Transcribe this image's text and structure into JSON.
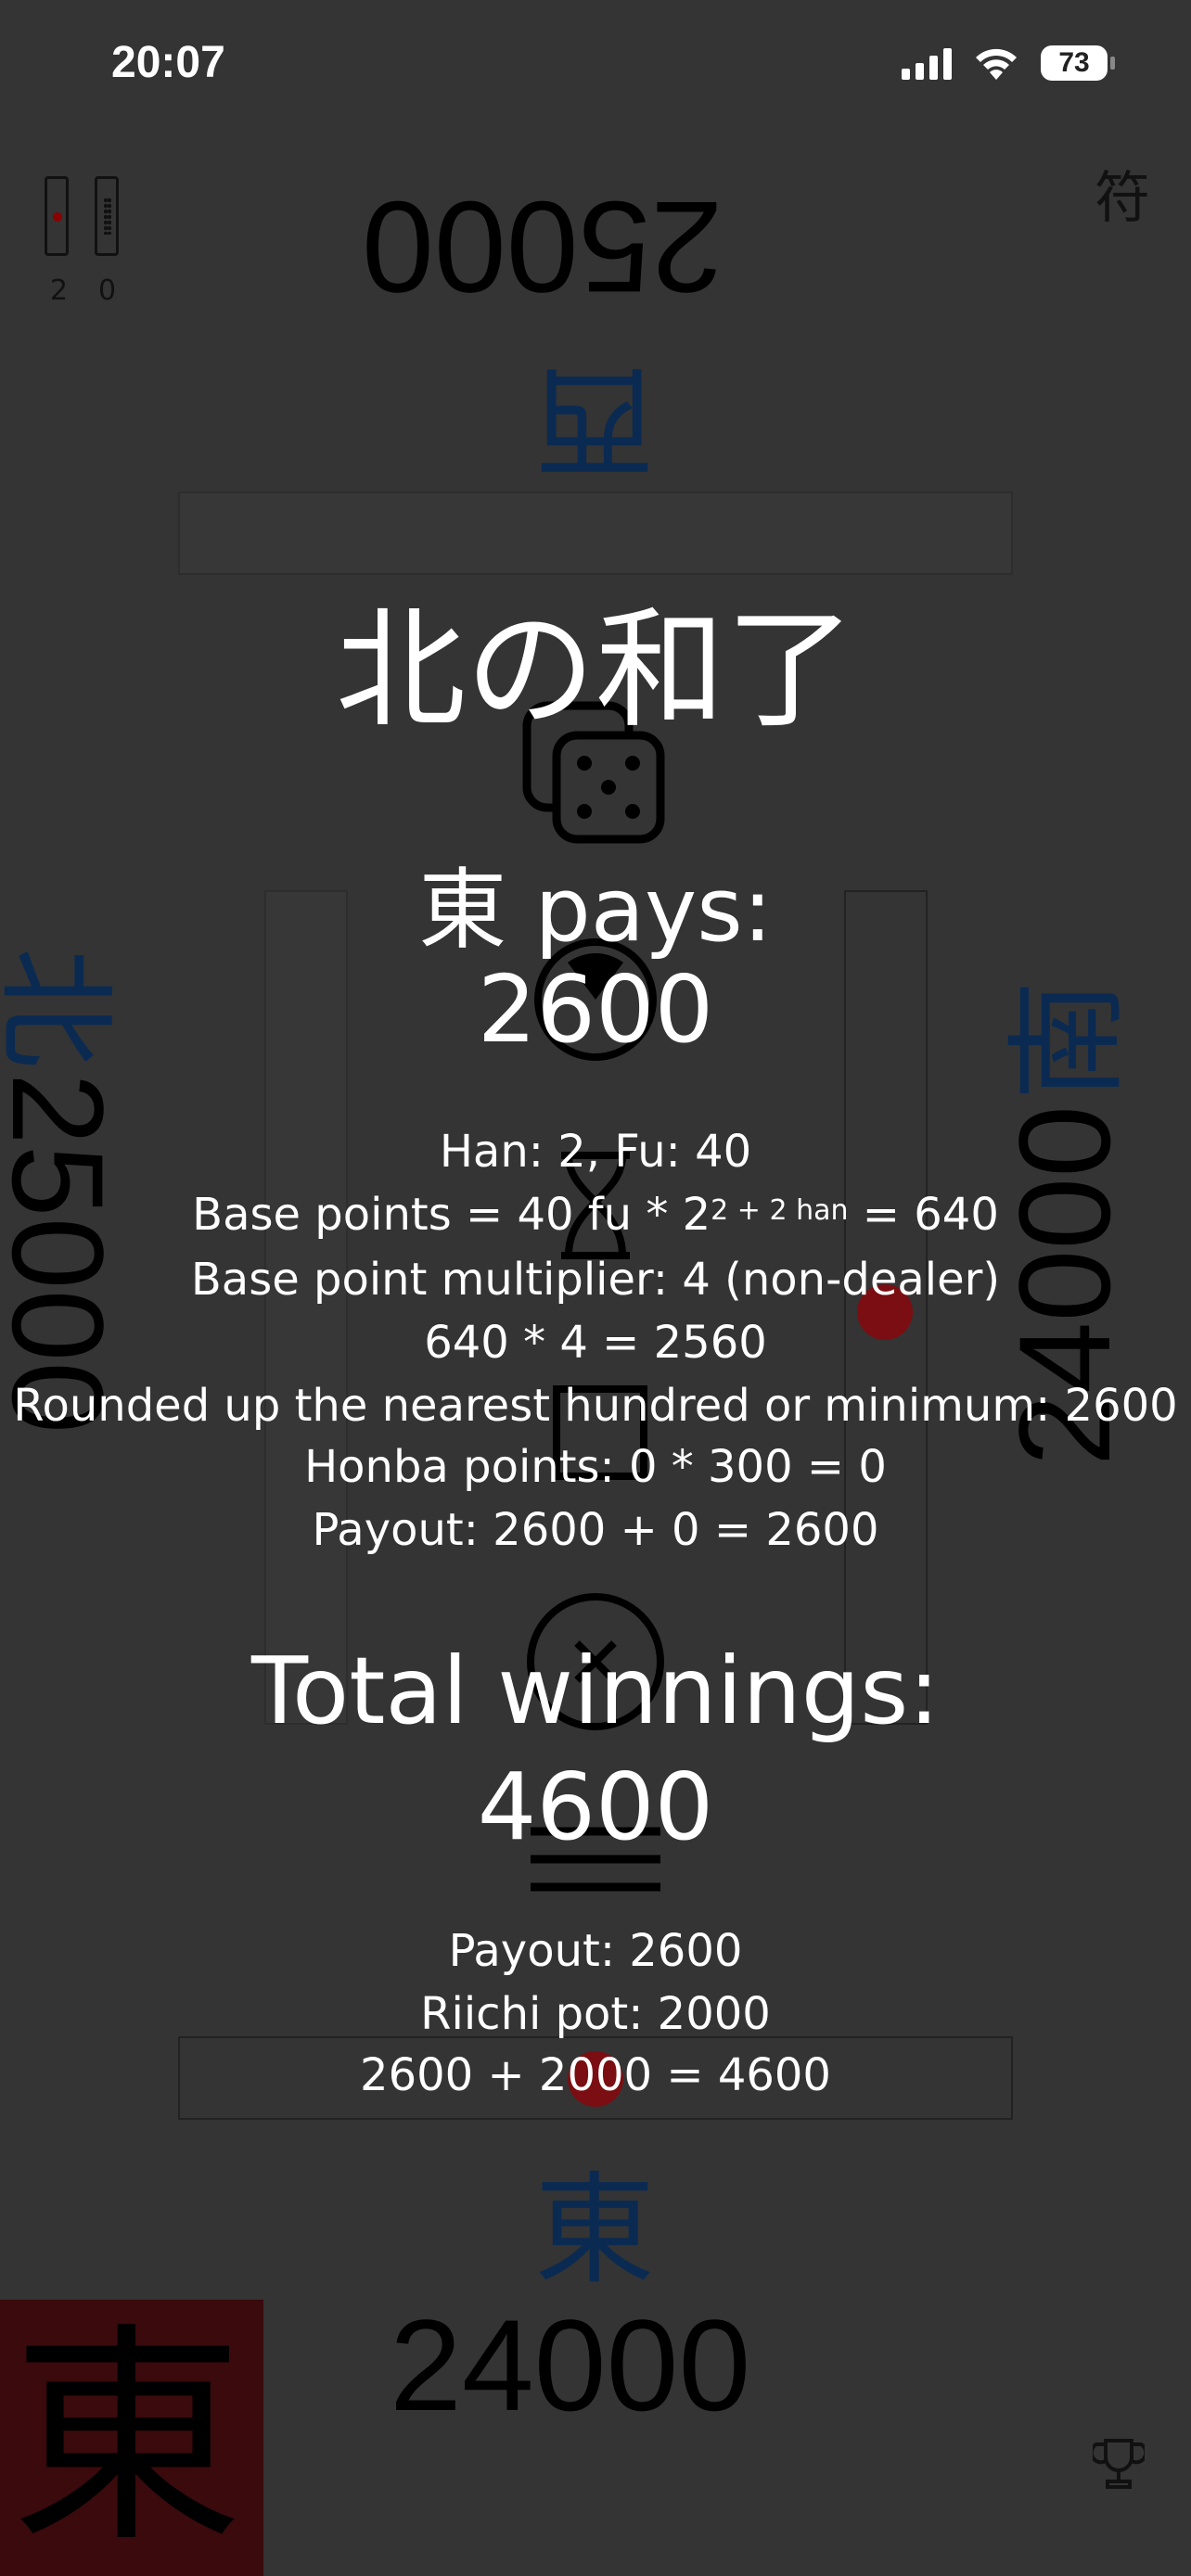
{
  "status_bar": {
    "time": "20:07",
    "battery": "73"
  },
  "sticks": {
    "riichi_count": "2",
    "honba_count": "0"
  },
  "icons": {
    "fu_table": "符",
    "trophy": "trophy-icon"
  },
  "players": {
    "top": {
      "score": "25000",
      "wind": "西"
    },
    "left": {
      "score": "25000",
      "wind": "北"
    },
    "right": {
      "score": "24000",
      "wind": "南"
    },
    "bottom": {
      "score": "24000",
      "wind": "東"
    },
    "dealer_marker": "東"
  },
  "result": {
    "title": "北の和了",
    "pays_label": "東 pays:",
    "pays_amount": "2600",
    "han_fu": "Han: 2, Fu: 40",
    "base_points_prefix": "Base points = 40 fu * 2",
    "base_points_exponent": "2 + 2 han",
    "base_points_suffix": " = 640",
    "multiplier": "Base point multiplier: 4 (non-dealer)",
    "product": "640 * 4 = 2560",
    "rounded": "Rounded up the nearest hundred or minimum: 2600",
    "honba": "Honba points: 0 * 300 = 0",
    "payout": "Payout: 2600 + 0 = 2600",
    "total_label": "Total winnings:",
    "total_amount": "4600",
    "total_payout": "Payout: 2600",
    "riichi_pot": "Riichi pot: 2000",
    "total_sum": "2600 + 2000 = 4600"
  },
  "colors": {
    "background": "#343434",
    "wind_blue": "#0a2a52",
    "dealer_red": "#3a0a0c",
    "riichi_red": "#7a0e12"
  }
}
